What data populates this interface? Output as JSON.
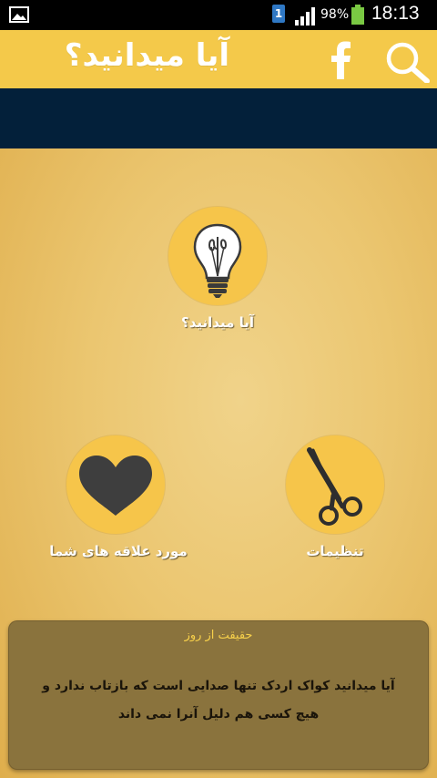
{
  "status_bar": {
    "sim_label": "1",
    "battery_percent": "98%",
    "time": "18:13"
  },
  "app_bar": {
    "title": "آیا میدانید؟",
    "facebook_icon": "facebook-icon",
    "search_icon": "search-icon",
    "background_color": "#f4c94a"
  },
  "banner": {
    "background_color": "#03203a"
  },
  "menu": {
    "items": [
      {
        "label": "آیا میدانید؟",
        "icon": "lightbulb-icon"
      },
      {
        "label": "مورد علاقه های شما",
        "icon": "heart-icon"
      },
      {
        "label": "تنظیمات",
        "icon": "scissors-icon"
      }
    ],
    "circle_color": "#f6c54a"
  },
  "fact_of_day": {
    "title": "حقیقت از روز",
    "text": "آیا میدانید کواک اردک تنها صدایی است که بازتاب ندارد و هیچ کسی هم دلیل آنرا نمی داند",
    "title_color": "#f7d04a"
  }
}
